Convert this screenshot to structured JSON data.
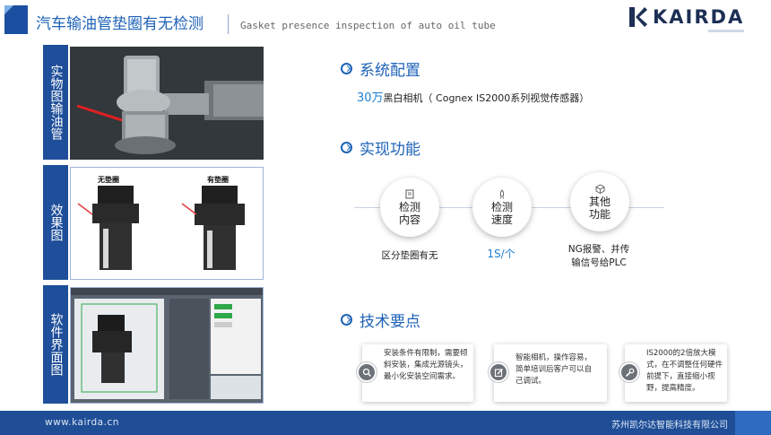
{
  "header": {
    "title_cn": "汽车输油管垫圈有无检测",
    "title_en": "Gasket presence inspection of auto oil tube",
    "brand": "KAIRDA"
  },
  "left_panels": [
    {
      "label": "实物图输油管"
    },
    {
      "label": "效果图",
      "image_captions": [
        "无垫圈",
        "有垫圈"
      ]
    },
    {
      "label": "软件界面图"
    }
  ],
  "sections": {
    "config": {
      "title": "系统配置",
      "highlight": "30万",
      "text": "黑白相机（ Cognex IS2000系列视觉传感器）"
    },
    "function": {
      "title": "实现功能",
      "items": [
        {
          "label_line1": "检测",
          "label_line2": "内容",
          "icon": "document-icon",
          "desc": "区分垫圈有无"
        },
        {
          "label_line1": "检测",
          "label_line2": "速度",
          "icon": "rocket-icon",
          "desc": "1S/个"
        },
        {
          "label_line1": "其他",
          "label_line2": "功能",
          "icon": "cube-icon",
          "desc_line1": "NG报警、并传",
          "desc_line2": "输信号给PLC"
        }
      ]
    },
    "tech": {
      "title": "技术要点",
      "cards": [
        {
          "icon": "search-icon",
          "text": "安装条件有限制，需要倾斜安装，集成光源镜头，最小化安装空间需求。"
        },
        {
          "icon": "edit-icon",
          "text": "智能相机，操作容易，简单培训后客户可以自己调试。"
        },
        {
          "icon": "wrench-icon",
          "text": "IS2000的2倍放大模式，在不调整任何硬件前提下，直接缩小视野，提高精度。"
        }
      ]
    }
  },
  "footer": {
    "url": "www.kairda.cn",
    "company": "苏州凯尔达智能科技有限公司"
  },
  "colors": {
    "primary": "#1e63b8",
    "dark_blue": "#1f4f9a",
    "highlight": "#1e7fd0"
  }
}
